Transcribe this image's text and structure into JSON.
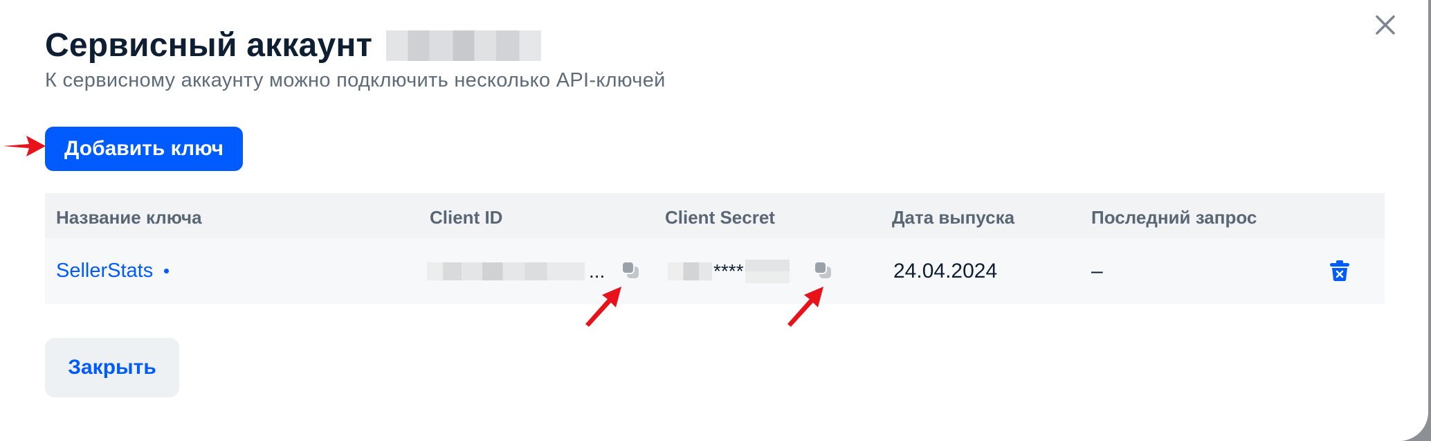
{
  "modal": {
    "title": "Сервисный аккаунт",
    "subtitle": "К сервисному аккаунту можно подключить несколько API-ключей",
    "add_key_button": "Добавить ключ",
    "close_button": "Закрыть"
  },
  "table": {
    "headers": [
      "Название ключа",
      "Client ID",
      "Client Secret",
      "Дата выпуска",
      "Последний запрос"
    ],
    "rows": [
      {
        "key_name": "SellerStats",
        "client_id_suffix": "...",
        "client_secret_mask": "****",
        "issue_date": "24.04.2024",
        "last_request": "–"
      }
    ]
  },
  "icons": {
    "close": "close-icon",
    "copy": "copy-icon",
    "delete": "trash-icon",
    "annotation": "red-arrow"
  },
  "colors": {
    "accent": "#005bff",
    "annotation": "#e8121b",
    "title": "#0f1f33",
    "muted": "#5e6b7a"
  }
}
